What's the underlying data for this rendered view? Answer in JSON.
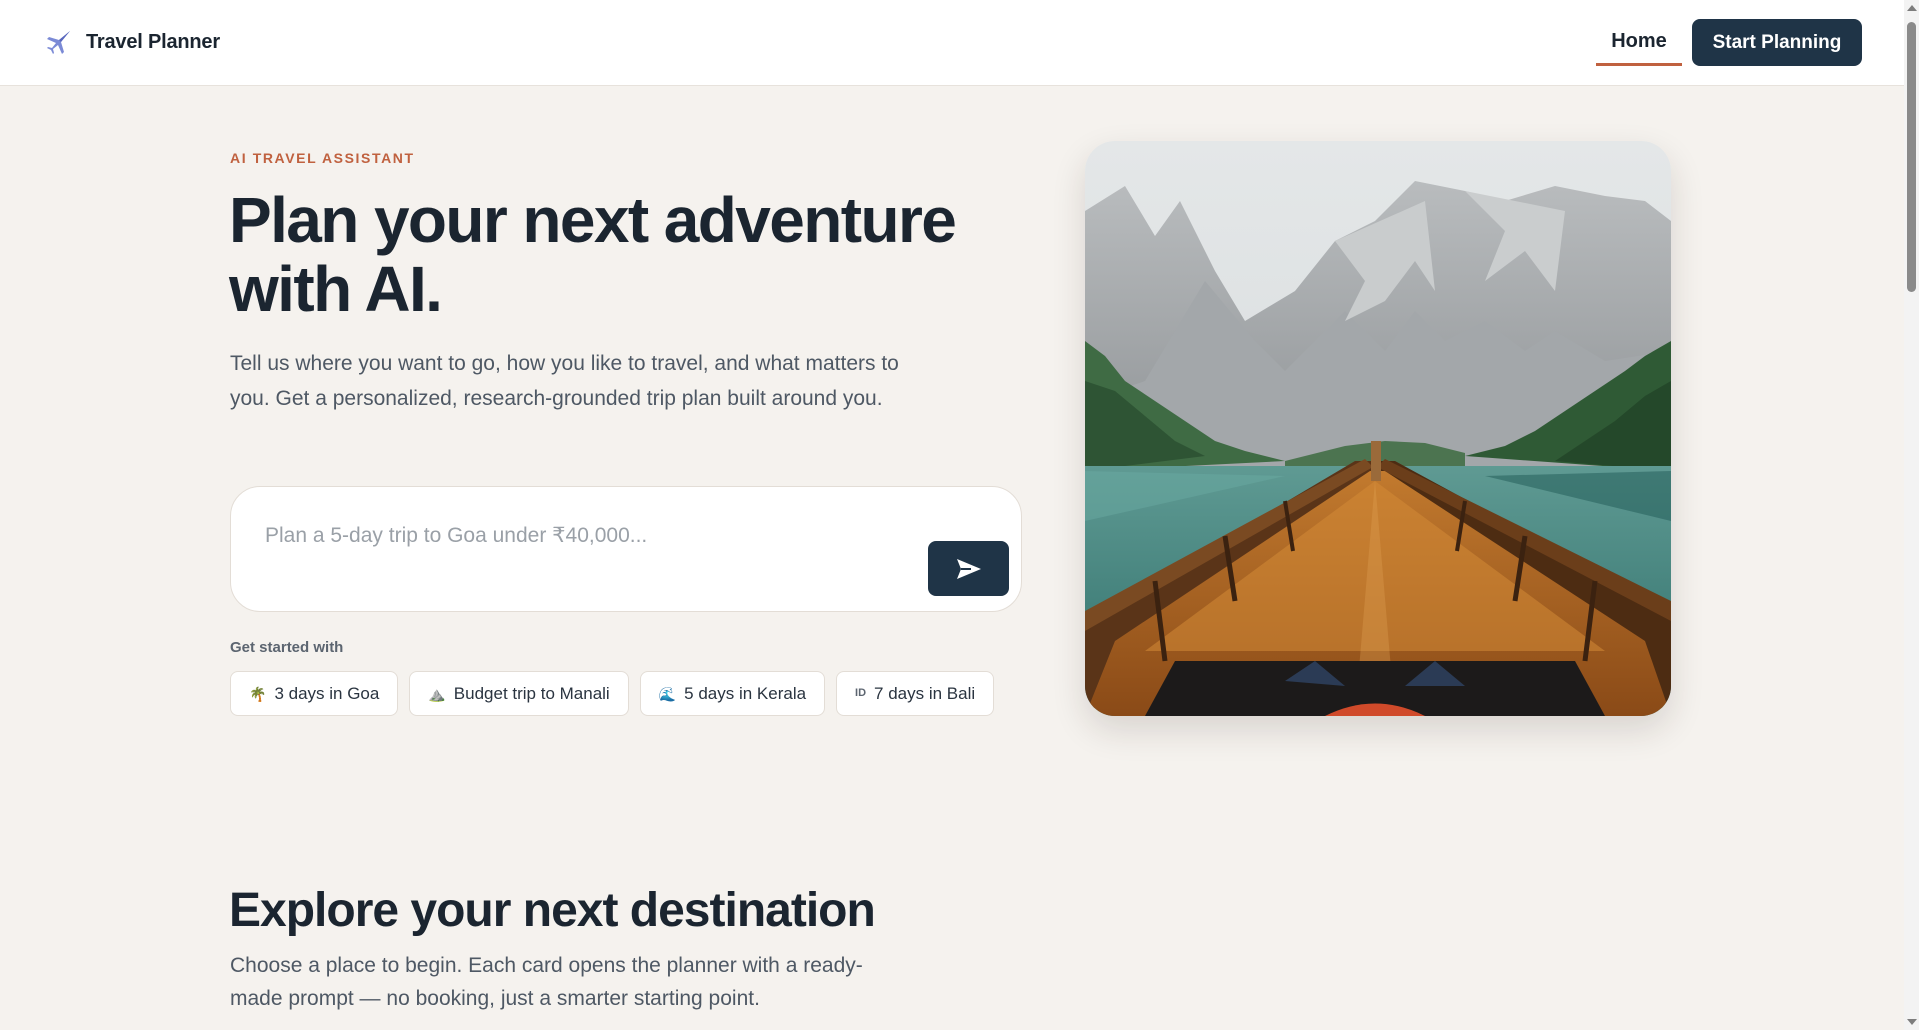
{
  "header": {
    "brand_name": "Travel Planner",
    "brand_icon": "airplane-icon",
    "nav_home": "Home",
    "cta": "Start Planning"
  },
  "hero": {
    "eyebrow": "AI TRAVEL ASSISTANT",
    "title_line1": "Plan your next adventure",
    "title_line2": "with AI.",
    "subtitle": "Tell us where you want to go, how you like to travel, and what matters to you. Get a personalized, research-grounded trip plan built around you.",
    "prompt": {
      "value": "",
      "placeholder": "Plan a 5-day trip to Goa under ₹40,000...",
      "send_icon": "send-icon"
    },
    "starters_label": "Get started with",
    "starters": [
      {
        "icon": "🌴",
        "label": "3 days in Goa"
      },
      {
        "icon": "⛰️",
        "label": "Budget trip to Manali"
      },
      {
        "icon": "🌊",
        "label": "5 days in Kerala"
      },
      {
        "icon": "ID",
        "label": "7 days in Bali"
      }
    ],
    "image_subject": "wooden boat bow on mountain lake"
  },
  "explore": {
    "title": "Explore your next destination",
    "subtitle": "Choose a place to begin. Each card opens the planner with a ready-made prompt — no booking, just a smarter starting point."
  },
  "colors": {
    "accent": "#c0613f",
    "primary": "#1f3447",
    "background": "#f5f2ee",
    "text": "#1b2530"
  }
}
